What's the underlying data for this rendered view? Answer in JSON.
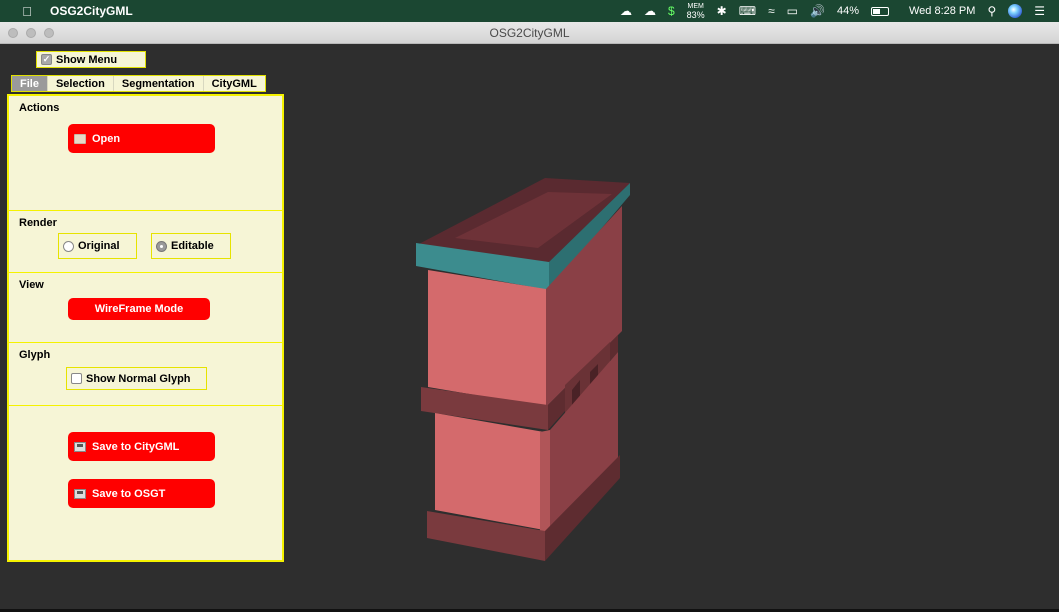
{
  "menubar": {
    "app_name": "OSG2CityGML",
    "mem_label": "MEM",
    "mem_value": "83%",
    "battery_percent": "44%",
    "clock": "Wed 8:28 PM"
  },
  "window": {
    "title": "OSG2CityGML"
  },
  "show_menu": {
    "label": "Show Menu",
    "checked": true
  },
  "tabs": [
    {
      "label": "File",
      "active": true
    },
    {
      "label": "Selection",
      "active": false
    },
    {
      "label": "Segmentation",
      "active": false
    },
    {
      "label": "CityGML",
      "active": false
    }
  ],
  "panel": {
    "actions": {
      "title": "Actions",
      "open_label": "Open"
    },
    "render": {
      "title": "Render",
      "original_label": "Original",
      "editable_label": "Editable",
      "selected": "Editable"
    },
    "view": {
      "title": "View",
      "wireframe_label": "WireFrame Mode"
    },
    "glyph": {
      "title": "Glyph",
      "normal_glyph_label": "Show Normal Glyph",
      "normal_glyph_checked": false
    },
    "save": {
      "citygml_label": "Save to CityGML",
      "osgt_label": "Save to OSGT"
    }
  },
  "colors": {
    "menubar_bg": "#1b4732",
    "viewport_bg": "#2e2e2e",
    "panel_bg": "#f6f5d6",
    "panel_border": "#f5f200",
    "button_red": "#ff0000",
    "model_face": "#d46a6c",
    "model_shadow": "#7a3a3e",
    "model_accent": "#3c8c8e"
  }
}
